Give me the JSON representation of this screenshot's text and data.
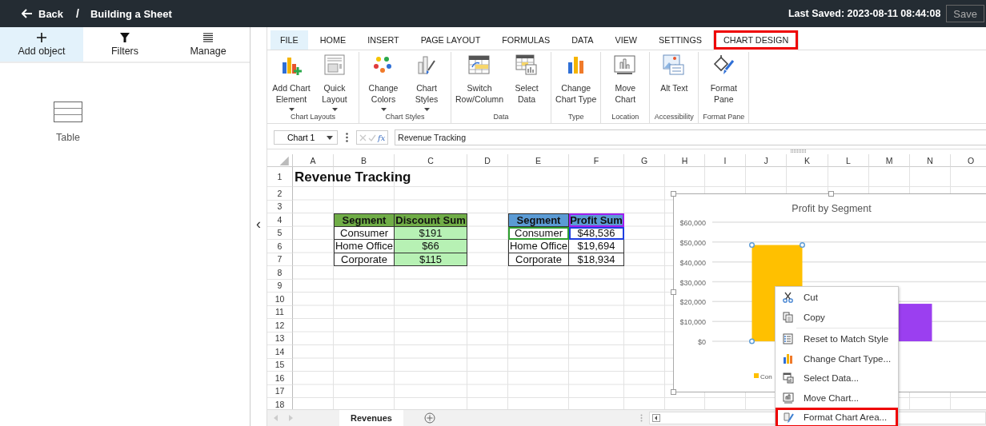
{
  "topbar": {
    "back": "Back",
    "separator": "/",
    "title": "Building a Sheet",
    "last_saved": "Last Saved: 2023-08-11 08:44:08",
    "save": "Save"
  },
  "left_panel": {
    "tabs": [
      {
        "label": "Add object",
        "kind": "plus",
        "selected": true
      },
      {
        "label": "Filters",
        "kind": "filter",
        "selected": false
      },
      {
        "label": "Manage",
        "kind": "list",
        "selected": false
      }
    ],
    "objects": [
      {
        "label": "Table",
        "kind": "table"
      }
    ],
    "collapse": "‹"
  },
  "ribbon": {
    "tabs": [
      {
        "label": "FILE",
        "selected": false,
        "hovered": true,
        "highlighted": false
      },
      {
        "label": "HOME",
        "selected": false,
        "hovered": false,
        "highlighted": false
      },
      {
        "label": "INSERT",
        "selected": false,
        "hovered": false,
        "highlighted": false
      },
      {
        "label": "PAGE LAYOUT",
        "selected": false,
        "hovered": false,
        "highlighted": false
      },
      {
        "label": "FORMULAS",
        "selected": false,
        "hovered": false,
        "highlighted": false
      },
      {
        "label": "DATA",
        "selected": false,
        "hovered": false,
        "highlighted": false
      },
      {
        "label": "VIEW",
        "selected": false,
        "hovered": false,
        "highlighted": false
      },
      {
        "label": "SETTINGS",
        "selected": false,
        "hovered": false,
        "highlighted": false
      },
      {
        "label": "CHART DESIGN",
        "selected": true,
        "hovered": false,
        "highlighted": true
      }
    ],
    "groups": [
      {
        "label": "Chart Layouts",
        "buttons": [
          {
            "label": "Add Chart\nElement",
            "kind": "add-element",
            "dropdown": true
          },
          {
            "label": "Quick\nLayout",
            "kind": "layout",
            "dropdown": true
          }
        ]
      },
      {
        "label": "Chart Styles",
        "buttons": [
          {
            "label": "Change\nColors",
            "kind": "colors",
            "dropdown": true
          },
          {
            "label": "Chart\nStyles",
            "kind": "styles",
            "dropdown": true
          }
        ]
      },
      {
        "label": "Data",
        "buttons": [
          {
            "label": "Switch\nRow/Column",
            "kind": "switch",
            "dropdown": false
          },
          {
            "label": "Select\nData",
            "kind": "select-data",
            "dropdown": false
          }
        ]
      },
      {
        "label": "Type",
        "buttons": [
          {
            "label": "Change\nChart Type",
            "kind": "chart-type",
            "dropdown": false
          }
        ]
      },
      {
        "label": "Location",
        "buttons": [
          {
            "label": "Move\nChart",
            "kind": "move",
            "dropdown": false
          }
        ]
      },
      {
        "label": "Accessibility",
        "buttons": [
          {
            "label": "Alt Text",
            "kind": "alt-text",
            "dropdown": false
          }
        ]
      },
      {
        "label": "Format Pane",
        "buttons": [
          {
            "label": "Format\nPane",
            "kind": "format",
            "dropdown": false
          }
        ]
      }
    ]
  },
  "formula_bar": {
    "name_box": "Chart 1",
    "function_label": "fx",
    "value": "Revenue Tracking"
  },
  "sheet": {
    "columns": [
      "A",
      "B",
      "C",
      "D",
      "E",
      "F",
      "G",
      "H",
      "I",
      "J",
      "K",
      "L",
      "M",
      "N",
      "O"
    ],
    "rows": [
      "1",
      "2",
      "3",
      "4",
      "5",
      "6",
      "7",
      "8",
      "9",
      "10",
      "11",
      "12",
      "13",
      "14",
      "15",
      "16",
      "17",
      "18"
    ],
    "title": "Revenue Tracking",
    "tables": [
      {
        "header": {
          "color": "#70ad47",
          "cells": [
            {
              "label": "Segment"
            },
            {
              "label": "Discount Sum"
            }
          ]
        },
        "rows": [
          [
            {
              "text": "Consumer"
            },
            {
              "text": "$191",
              "color": "#b7f1b4"
            }
          ],
          [
            {
              "text": "Home Office"
            },
            {
              "text": "$66",
              "color": "#b7f1b4"
            }
          ],
          [
            {
              "text": "Corporate"
            },
            {
              "text": "$115",
              "color": "#b7f1b4"
            }
          ]
        ]
      },
      {
        "header": {
          "color": "#5b9bd5",
          "cells": [
            {
              "label": "Segment"
            },
            {
              "label": "Profit Sum",
              "range": {
                "color": "#a020f0"
              }
            }
          ]
        },
        "rows": [
          [
            {
              "text": "Consumer",
              "range": {
                "color": "#2e9e2e"
              }
            },
            {
              "text": "$48,536",
              "range": {
                "color": "#1f3fe0"
              }
            }
          ],
          [
            {
              "text": "Home Office"
            },
            {
              "text": "$19,694"
            }
          ],
          [
            {
              "text": "Corporate"
            },
            {
              "text": "$18,934"
            }
          ]
        ]
      }
    ],
    "chart": {
      "chart_data": {
        "type": "bar",
        "title": "Profit by Segment",
        "grid": true,
        "series": [
          {
            "color": "#ffc000",
            "values": [
              48500,
              null,
              null
            ]
          },
          {
            "color": "#9b3ff0",
            "values": [
              null,
              null,
              18900
            ]
          }
        ],
        "ylim": [
          0,
          60000
        ],
        "yticks": [
          {
            "value": 0,
            "label": "$0"
          },
          {
            "value": 10000,
            "label": "$10,000"
          },
          {
            "value": 20000,
            "label": "$20,000"
          },
          {
            "value": 30000,
            "label": "$30,000"
          },
          {
            "value": 40000,
            "label": "$40,000"
          },
          {
            "value": 50000,
            "label": "$50,000"
          },
          {
            "value": 60000,
            "label": "$60,000"
          }
        ]
      },
      "legend": [
        {
          "label": "Con",
          "color": "#ffc000"
        }
      ]
    },
    "context_menu": {
      "items": [
        {
          "label": "Cut",
          "kind": "cut",
          "highlighted": false
        },
        {
          "label": "Copy",
          "kind": "copy",
          "highlighted": false
        },
        {
          "label": "Reset to Match Style",
          "kind": "reset",
          "highlighted": false
        },
        {
          "label": "Change Chart Type...",
          "kind": "chart-type",
          "highlighted": false
        },
        {
          "label": "Select Data...",
          "kind": "select-data",
          "highlighted": false
        },
        {
          "label": "Move Chart...",
          "kind": "move",
          "highlighted": false
        },
        {
          "label": "Format Chart Area...",
          "kind": "format-area",
          "highlighted": true
        }
      ]
    },
    "sheet_tabs": [
      {
        "label": "Revenues",
        "selected": true
      }
    ]
  }
}
